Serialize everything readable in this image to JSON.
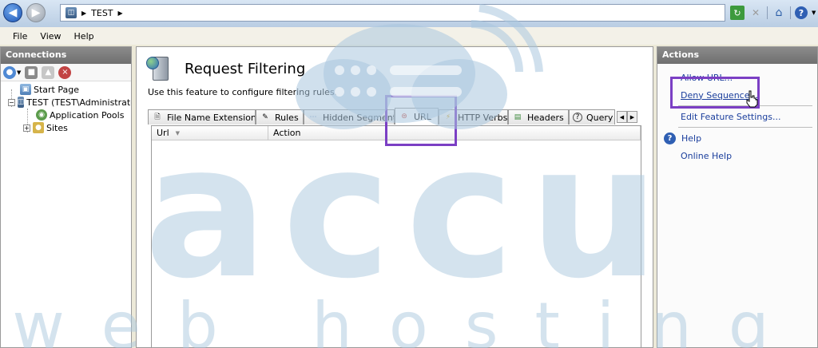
{
  "address_bar": {
    "path": "TEST"
  },
  "menu": {
    "items": [
      "File",
      "View",
      "Help"
    ]
  },
  "connections": {
    "title": "Connections",
    "tree": [
      {
        "label": "Start Page"
      },
      {
        "label": "TEST (TEST\\Administrato"
      },
      {
        "label": "Application Pools"
      },
      {
        "label": "Sites"
      }
    ]
  },
  "feature": {
    "title": "Request Filtering",
    "description": "Use this feature to configure filtering rules.",
    "tabs": [
      {
        "label": "File Name Extensions"
      },
      {
        "label": "Rules"
      },
      {
        "label": "Hidden Segments"
      },
      {
        "label": "URL"
      },
      {
        "label": "HTTP Verbs"
      },
      {
        "label": "Headers"
      },
      {
        "label": "Query"
      }
    ],
    "active_tab": "URL",
    "grid_columns": [
      "Url",
      "Action"
    ]
  },
  "actions": {
    "title": "Actions",
    "items": [
      {
        "label": "Allow URL..."
      },
      {
        "label": "Deny Sequence..."
      },
      {
        "label": "Edit Feature Settings..."
      },
      {
        "label": "Help"
      },
      {
        "label": "Online Help"
      }
    ]
  },
  "watermark": {
    "brand": "accu",
    "tagline": "web hosting"
  },
  "colors": {
    "highlight": "#7b3fc4",
    "link": "#1a3e9c",
    "panel_header": "#7d7d7d",
    "watermark": "#a9c7de"
  }
}
